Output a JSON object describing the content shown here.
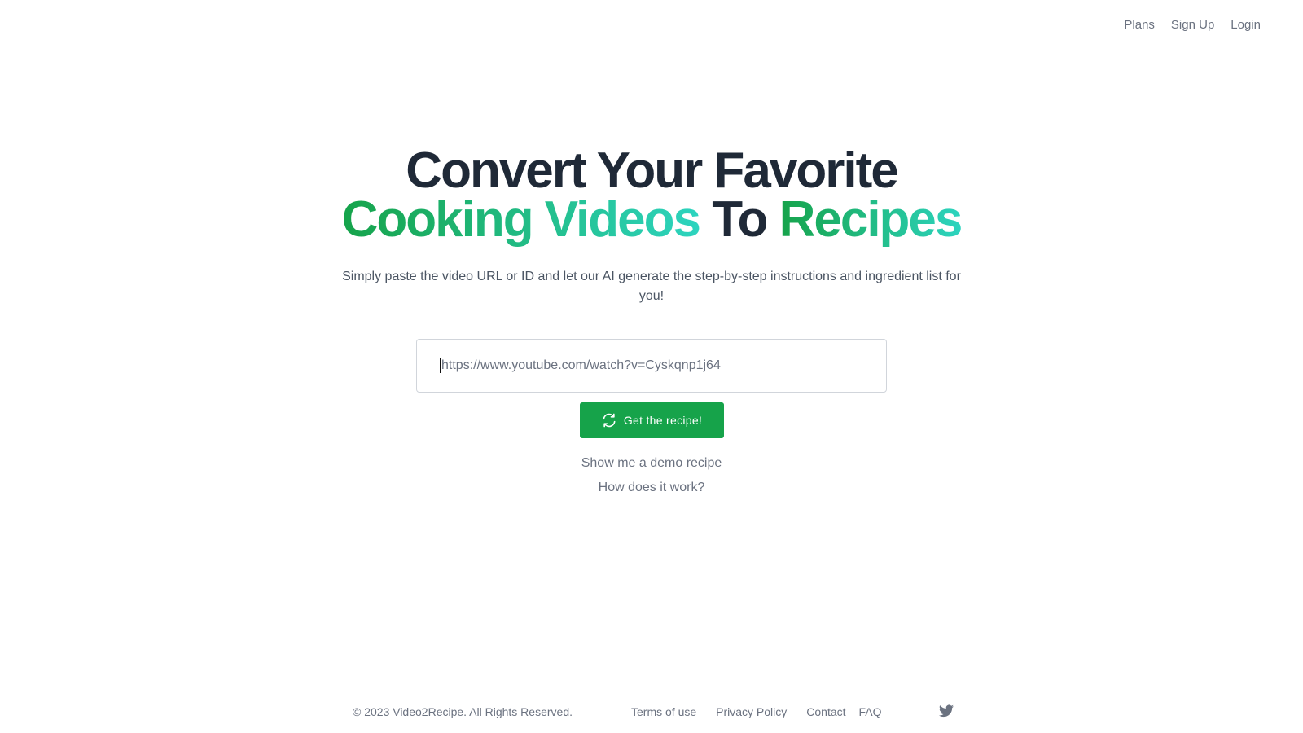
{
  "nav": {
    "items": [
      {
        "label": "Plans"
      },
      {
        "label": "Sign Up"
      },
      {
        "label": "Login"
      }
    ]
  },
  "hero": {
    "line1": "Convert Your Favorite",
    "line2_part1": "Cooking Videos",
    "line2_part2": "To",
    "line2_part3": "Recipes",
    "subtitle": "Simply paste the video URL or ID and let our AI generate the step-by-step instructions and ingredient list for you!"
  },
  "form": {
    "url_placeholder": "https://www.youtube.com/watch?v=Cyskqnp1j64",
    "url_value": "",
    "submit_label": "Get the recipe!",
    "submit_icon": "refresh-icon"
  },
  "links": {
    "demo": "Show me a demo recipe",
    "how": "How does it work?"
  },
  "footer": {
    "copyright": "© 2023 Video2Recipe. All Rights Reserved.",
    "links": [
      {
        "label": "Terms of use"
      },
      {
        "label": "Privacy Policy"
      },
      {
        "label": "Contact"
      },
      {
        "label": "FAQ"
      }
    ],
    "social_icon": "twitter-icon"
  },
  "colors": {
    "brand_green": "#16a34a",
    "accent_teal": "#2dd4bf",
    "text_dark": "#1f2937",
    "text_muted": "#6b7280"
  }
}
